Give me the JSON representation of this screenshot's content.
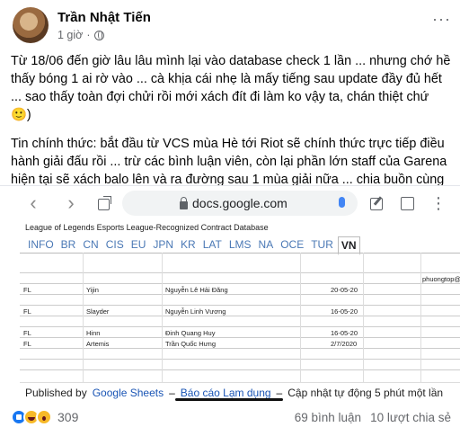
{
  "post": {
    "author": "Trần Nhật Tiến",
    "time": "1 giờ",
    "more": "···",
    "paragraphs": [
      "Từ 18/06 đến giờ lâu lâu mình lại vào database check 1 lần ... nhưng chớ hề thấy bóng 1 ai rờ vào ... cà khịa cái nhẹ là mấy tiếng sau update đầy đủ hết ... sao thấy toàn đợi chửi rồi mới xách đít đi làm ko vậy ta, chán thiệt chứ 🙂)",
      "Tin chính thức: bắt đầu từ VCS mùa Hè tới Riot sẽ chính thức trực tiếp điều hành giải đấu rồi ... trừ các bình luận viên, còn lại phần lớn staff của Garena hiện tại sẽ xách balo lên và ra đường sau 1 mùa giải nữa ... chia buồn cùng các anh chị nhé 😔😔😔"
    ]
  },
  "browser": {
    "back": "‹",
    "forward": "›",
    "url": "docs.google.com",
    "kebab": "⋮"
  },
  "sheet": {
    "title": "League of Legends Esports League-Recognized Contract Database",
    "tabs": [
      "INFO",
      "BR",
      "CN",
      "CIS",
      "EU",
      "JPN",
      "KR",
      "LAT",
      "LMS",
      "NA",
      "OCE",
      "TUR",
      "VN"
    ],
    "active_tab": "VN",
    "email_cell": "phuongtop@tear",
    "rows": [
      {
        "pos": "FL",
        "name": "Yijin",
        "real": "Nguyễn Lê Hải Đăng",
        "date": "20-05-20"
      },
      {
        "pos": "FL",
        "name": "Slayder",
        "real": "Nguyễn Linh Vương",
        "date": "16-05-20"
      },
      {
        "pos": "FL",
        "name": "Hinn",
        "real": "Đinh Quang Huy",
        "date": "16-05-20"
      },
      {
        "pos": "FL",
        "name": "Artemis",
        "real": "Trần Quốc Hưng",
        "date": "2/7/2020"
      }
    ]
  },
  "sheet_footer": {
    "published": "Published by",
    "google_sheets": "Google Sheets",
    "sep1": "–",
    "report": "Báo cáo Lạm dụng",
    "sep2": "–",
    "auto_update": "Cập nhật tự động 5 phút một lần"
  },
  "reactions": {
    "count": "309",
    "comments": "69 bình luận",
    "shares": "10 lượt chia sẻ"
  }
}
